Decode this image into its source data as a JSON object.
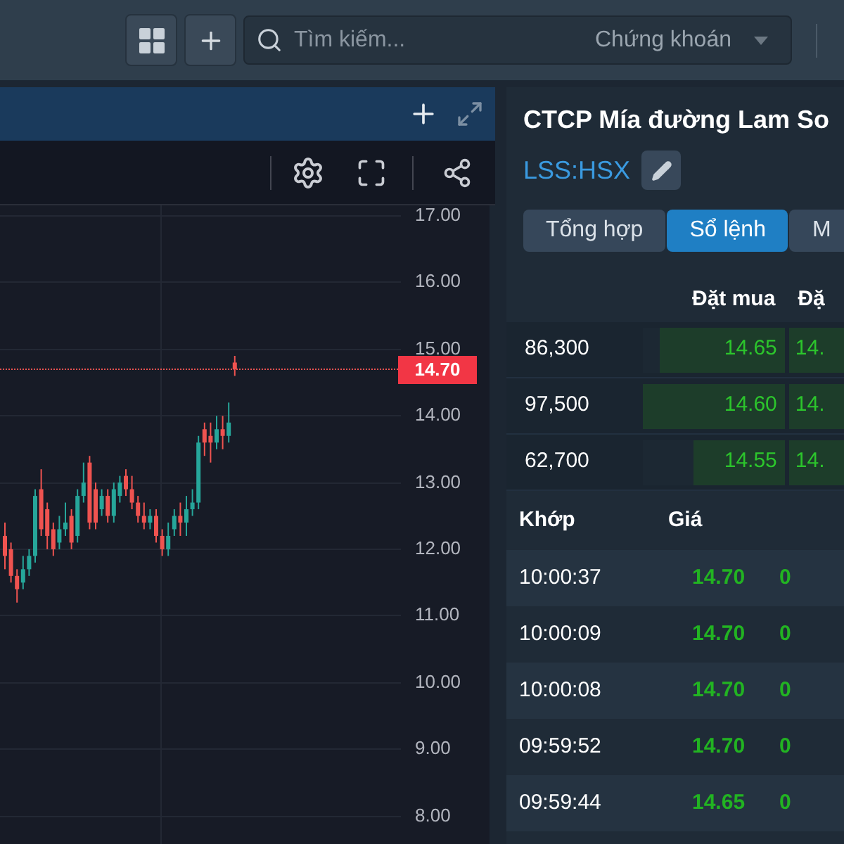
{
  "top_bar": {
    "search": {
      "placeholder": "Tìm kiếm..."
    },
    "category": "Chứng khoán"
  },
  "chart_panel": {
    "price_axis": [
      "17.00",
      "16.00",
      "15.00",
      "14.00",
      "13.00",
      "12.00",
      "11.00",
      "10.00",
      "9.00",
      "8.00"
    ],
    "last_price": "14.70"
  },
  "stock_panel": {
    "title": "CTCP Mía đường Lam So",
    "ticker": "LSS:HSX",
    "tabs": [
      {
        "label": "Tổng hợp",
        "selected": false
      },
      {
        "label": "Sổ lệnh",
        "selected": true
      },
      {
        "label": "M",
        "selected": false
      }
    ],
    "order_book": {
      "columns": [
        "Đặt mua",
        "Đặ"
      ],
      "rows": [
        {
          "volume": "86,300",
          "bid": "14.65",
          "level": 0.88,
          "column_3": "14."
        },
        {
          "volume": "97,500",
          "bid": "14.60",
          "level": 1,
          "column_3": "14."
        },
        {
          "volume": "62,700",
          "bid": "14.55",
          "level": 0.64,
          "column_3": "14."
        }
      ]
    },
    "matches": {
      "columns": [
        "Khớp",
        "Giá"
      ],
      "rows": [
        {
          "time": "10:00:37",
          "price": "14.70",
          "column_3": "0"
        },
        {
          "time": "10:00:09",
          "price": "14.70",
          "column_3": "0"
        },
        {
          "time": "10:00:08",
          "price": "14.70",
          "column_3": "0"
        },
        {
          "time": "09:59:52",
          "price": "14.70",
          "column_3": "0"
        },
        {
          "time": "09:59:44",
          "price": "14.65",
          "column_3": "0"
        }
      ]
    }
  }
}
